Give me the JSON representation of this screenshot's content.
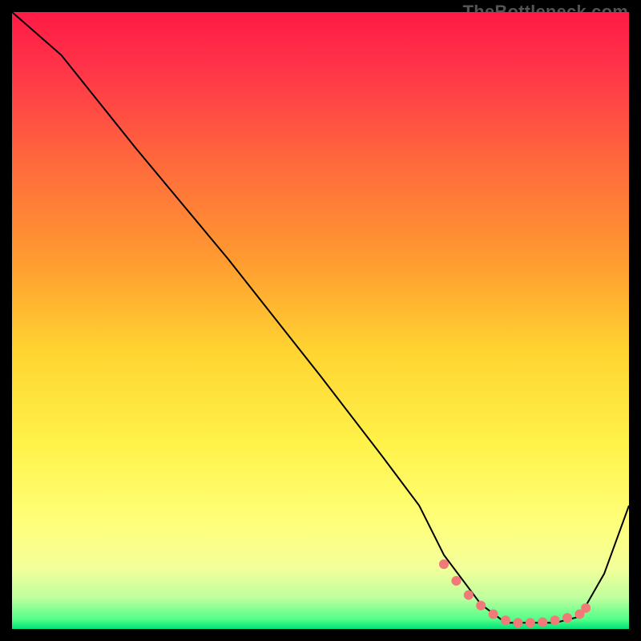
{
  "watermark": "TheBottleneck.com",
  "gradient_stops": [
    {
      "offset": 0.0,
      "color": "#ff1a46"
    },
    {
      "offset": 0.1,
      "color": "#ff3748"
    },
    {
      "offset": 0.25,
      "color": "#ff6b3c"
    },
    {
      "offset": 0.4,
      "color": "#ff9a30"
    },
    {
      "offset": 0.55,
      "color": "#ffd431"
    },
    {
      "offset": 0.7,
      "color": "#fff24a"
    },
    {
      "offset": 0.82,
      "color": "#ffff77"
    },
    {
      "offset": 0.9,
      "color": "#f4ff9a"
    },
    {
      "offset": 0.95,
      "color": "#bfff9e"
    },
    {
      "offset": 0.985,
      "color": "#4fff88"
    },
    {
      "offset": 1.0,
      "color": "#00e07a"
    }
  ],
  "chart_data": {
    "type": "line",
    "title": "",
    "xlabel": "",
    "ylabel": "",
    "xlim": [
      0,
      100
    ],
    "ylim": [
      0,
      100
    ],
    "series": [
      {
        "name": "curve",
        "stroke": "#000000",
        "stroke_width": 2,
        "x": [
          0,
          8,
          20,
          35,
          50,
          60,
          66,
          70,
          76,
          80,
          84,
          88,
          92,
          96,
          100
        ],
        "y": [
          100,
          93,
          78,
          60,
          41,
          28,
          20,
          12,
          4,
          1,
          1,
          1,
          2,
          9,
          20
        ]
      },
      {
        "name": "valley-dots",
        "type": "scatter",
        "color": "#f07a78",
        "radius": 6,
        "x": [
          70,
          72,
          74,
          76,
          78,
          80,
          82,
          84,
          86,
          88,
          90,
          92,
          93
        ],
        "y": [
          10.5,
          7.8,
          5.5,
          3.8,
          2.4,
          1.4,
          1.0,
          1.0,
          1.1,
          1.4,
          1.8,
          2.4,
          3.4
        ]
      }
    ]
  },
  "colors": {
    "frame": "#000000",
    "line": "#000000",
    "dot": "#f07a78",
    "wm": "#545454"
  }
}
